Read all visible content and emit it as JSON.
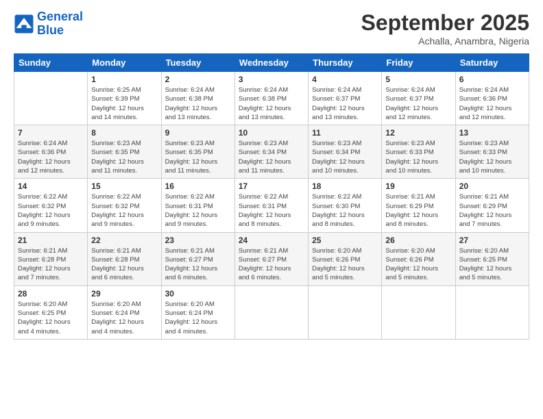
{
  "logo": {
    "line1": "General",
    "line2": "Blue"
  },
  "title": "September 2025",
  "subtitle": "Achalla, Anambra, Nigeria",
  "days_of_week": [
    "Sunday",
    "Monday",
    "Tuesday",
    "Wednesday",
    "Thursday",
    "Friday",
    "Saturday"
  ],
  "weeks": [
    [
      {
        "num": "",
        "info": ""
      },
      {
        "num": "1",
        "info": "Sunrise: 6:25 AM\nSunset: 6:39 PM\nDaylight: 12 hours\nand 14 minutes."
      },
      {
        "num": "2",
        "info": "Sunrise: 6:24 AM\nSunset: 6:38 PM\nDaylight: 12 hours\nand 13 minutes."
      },
      {
        "num": "3",
        "info": "Sunrise: 6:24 AM\nSunset: 6:38 PM\nDaylight: 12 hours\nand 13 minutes."
      },
      {
        "num": "4",
        "info": "Sunrise: 6:24 AM\nSunset: 6:37 PM\nDaylight: 12 hours\nand 13 minutes."
      },
      {
        "num": "5",
        "info": "Sunrise: 6:24 AM\nSunset: 6:37 PM\nDaylight: 12 hours\nand 12 minutes."
      },
      {
        "num": "6",
        "info": "Sunrise: 6:24 AM\nSunset: 6:36 PM\nDaylight: 12 hours\nand 12 minutes."
      }
    ],
    [
      {
        "num": "7",
        "info": "Sunrise: 6:24 AM\nSunset: 6:36 PM\nDaylight: 12 hours\nand 12 minutes."
      },
      {
        "num": "8",
        "info": "Sunrise: 6:23 AM\nSunset: 6:35 PM\nDaylight: 12 hours\nand 11 minutes."
      },
      {
        "num": "9",
        "info": "Sunrise: 6:23 AM\nSunset: 6:35 PM\nDaylight: 12 hours\nand 11 minutes."
      },
      {
        "num": "10",
        "info": "Sunrise: 6:23 AM\nSunset: 6:34 PM\nDaylight: 12 hours\nand 11 minutes."
      },
      {
        "num": "11",
        "info": "Sunrise: 6:23 AM\nSunset: 6:34 PM\nDaylight: 12 hours\nand 10 minutes."
      },
      {
        "num": "12",
        "info": "Sunrise: 6:23 AM\nSunset: 6:33 PM\nDaylight: 12 hours\nand 10 minutes."
      },
      {
        "num": "13",
        "info": "Sunrise: 6:23 AM\nSunset: 6:33 PM\nDaylight: 12 hours\nand 10 minutes."
      }
    ],
    [
      {
        "num": "14",
        "info": "Sunrise: 6:22 AM\nSunset: 6:32 PM\nDaylight: 12 hours\nand 9 minutes."
      },
      {
        "num": "15",
        "info": "Sunrise: 6:22 AM\nSunset: 6:32 PM\nDaylight: 12 hours\nand 9 minutes."
      },
      {
        "num": "16",
        "info": "Sunrise: 6:22 AM\nSunset: 6:31 PM\nDaylight: 12 hours\nand 9 minutes."
      },
      {
        "num": "17",
        "info": "Sunrise: 6:22 AM\nSunset: 6:31 PM\nDaylight: 12 hours\nand 8 minutes."
      },
      {
        "num": "18",
        "info": "Sunrise: 6:22 AM\nSunset: 6:30 PM\nDaylight: 12 hours\nand 8 minutes."
      },
      {
        "num": "19",
        "info": "Sunrise: 6:21 AM\nSunset: 6:29 PM\nDaylight: 12 hours\nand 8 minutes."
      },
      {
        "num": "20",
        "info": "Sunrise: 6:21 AM\nSunset: 6:29 PM\nDaylight: 12 hours\nand 7 minutes."
      }
    ],
    [
      {
        "num": "21",
        "info": "Sunrise: 6:21 AM\nSunset: 6:28 PM\nDaylight: 12 hours\nand 7 minutes."
      },
      {
        "num": "22",
        "info": "Sunrise: 6:21 AM\nSunset: 6:28 PM\nDaylight: 12 hours\nand 6 minutes."
      },
      {
        "num": "23",
        "info": "Sunrise: 6:21 AM\nSunset: 6:27 PM\nDaylight: 12 hours\nand 6 minutes."
      },
      {
        "num": "24",
        "info": "Sunrise: 6:21 AM\nSunset: 6:27 PM\nDaylight: 12 hours\nand 6 minutes."
      },
      {
        "num": "25",
        "info": "Sunrise: 6:20 AM\nSunset: 6:26 PM\nDaylight: 12 hours\nand 5 minutes."
      },
      {
        "num": "26",
        "info": "Sunrise: 6:20 AM\nSunset: 6:26 PM\nDaylight: 12 hours\nand 5 minutes."
      },
      {
        "num": "27",
        "info": "Sunrise: 6:20 AM\nSunset: 6:25 PM\nDaylight: 12 hours\nand 5 minutes."
      }
    ],
    [
      {
        "num": "28",
        "info": "Sunrise: 6:20 AM\nSunset: 6:25 PM\nDaylight: 12 hours\nand 4 minutes."
      },
      {
        "num": "29",
        "info": "Sunrise: 6:20 AM\nSunset: 6:24 PM\nDaylight: 12 hours\nand 4 minutes."
      },
      {
        "num": "30",
        "info": "Sunrise: 6:20 AM\nSunset: 6:24 PM\nDaylight: 12 hours\nand 4 minutes."
      },
      {
        "num": "",
        "info": ""
      },
      {
        "num": "",
        "info": ""
      },
      {
        "num": "",
        "info": ""
      },
      {
        "num": "",
        "info": ""
      }
    ]
  ]
}
